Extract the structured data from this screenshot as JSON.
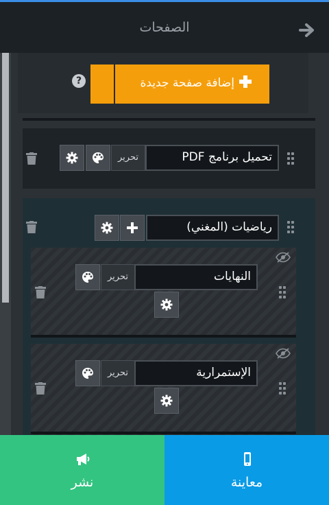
{
  "header": {
    "title": "الصفحات",
    "back_icon": "arrow-right-icon"
  },
  "add_page": {
    "label": "إضافة صفحة جديدة",
    "help": "?",
    "color": "#f59e0b"
  },
  "pages": [
    {
      "name": "تحميل برنامج PDF",
      "edit": "تحرير"
    }
  ],
  "section": {
    "name": "رياضيات  (المغني)",
    "children": [
      {
        "name": "النهايات",
        "edit": "تحرير"
      },
      {
        "name": "الإستمرارية",
        "edit": "تحرير"
      }
    ]
  },
  "footer": {
    "publish": "نشر",
    "preview": "معاينة",
    "publish_color": "#33c481",
    "preview_color": "#0a9be6"
  }
}
